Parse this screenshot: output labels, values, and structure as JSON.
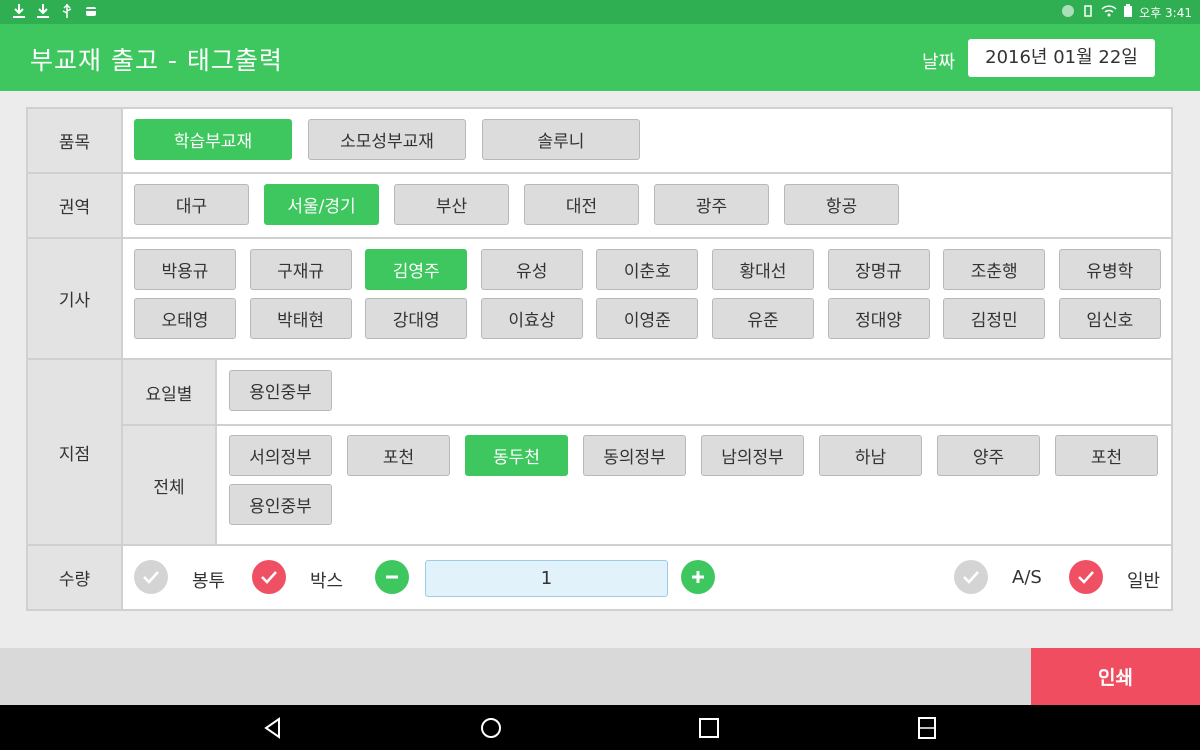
{
  "status_bar": {
    "left_icons": [
      "download-icon",
      "download-icon",
      "usb-icon",
      "android-debug-icon"
    ],
    "right_icons": [
      "bluetooth-icon",
      "vibrate-icon",
      "wifi-icon",
      "battery-icon"
    ],
    "time": "오후 3:41"
  },
  "header": {
    "title": "부교재 출고 - 태그출력",
    "date_label": "날짜",
    "date_value": "2016년 01월 22일"
  },
  "form": {
    "item": {
      "label": "품목",
      "options": [
        {
          "text": "학습부교재",
          "selected": true
        },
        {
          "text": "소모성부교재",
          "selected": false
        },
        {
          "text": "솔루니",
          "selected": false
        }
      ]
    },
    "region": {
      "label": "권역",
      "options": [
        {
          "text": "대구",
          "selected": false
        },
        {
          "text": "서울/경기",
          "selected": true
        },
        {
          "text": "부산",
          "selected": false
        },
        {
          "text": "대전",
          "selected": false
        },
        {
          "text": "광주",
          "selected": false
        },
        {
          "text": "항공",
          "selected": false
        }
      ]
    },
    "driver": {
      "label": "기사",
      "options": [
        {
          "text": "박용규",
          "selected": false
        },
        {
          "text": "구재규",
          "selected": false
        },
        {
          "text": "김영주",
          "selected": true
        },
        {
          "text": "유성",
          "selected": false
        },
        {
          "text": "이춘호",
          "selected": false
        },
        {
          "text": "황대선",
          "selected": false
        },
        {
          "text": "장명규",
          "selected": false
        },
        {
          "text": "조춘행",
          "selected": false
        },
        {
          "text": "유병학",
          "selected": false
        },
        {
          "text": "오태영",
          "selected": false
        },
        {
          "text": "박태현",
          "selected": false
        },
        {
          "text": "강대영",
          "selected": false
        },
        {
          "text": "이효상",
          "selected": false
        },
        {
          "text": "이영준",
          "selected": false
        },
        {
          "text": "유준",
          "selected": false
        },
        {
          "text": "정대양",
          "selected": false
        },
        {
          "text": "김정민",
          "selected": false
        },
        {
          "text": "임신호",
          "selected": false
        }
      ]
    },
    "branch": {
      "label": "지점",
      "by_day": {
        "label": "요일별",
        "options": [
          {
            "text": "용인중부",
            "selected": false
          }
        ]
      },
      "all": {
        "label": "전체",
        "options": [
          {
            "text": "서의정부",
            "selected": false
          },
          {
            "text": "포천",
            "selected": false
          },
          {
            "text": "동두천",
            "selected": true
          },
          {
            "text": "동의정부",
            "selected": false
          },
          {
            "text": "남의정부",
            "selected": false
          },
          {
            "text": "하남",
            "selected": false
          },
          {
            "text": "양주",
            "selected": false
          },
          {
            "text": "포천",
            "selected": false
          },
          {
            "text": "용인중부",
            "selected": false
          }
        ]
      }
    },
    "quantity": {
      "label": "수량",
      "bag_label": "봉투",
      "bag_checked": false,
      "box_label": "박스",
      "box_checked": true,
      "value": "1",
      "as_label": "A/S",
      "as_checked": false,
      "normal_label": "일반",
      "normal_checked": true
    }
  },
  "actions": {
    "print_label": "인쇄"
  },
  "nav": [
    "back-icon",
    "home-icon",
    "recents-icon",
    "split-screen-icon"
  ],
  "colors": {
    "accent": "#3ec75e",
    "status_bar": "#2fae52",
    "danger": "#f04e60",
    "button": "#dcdcdc",
    "input_bg": "#e1f2fb"
  }
}
